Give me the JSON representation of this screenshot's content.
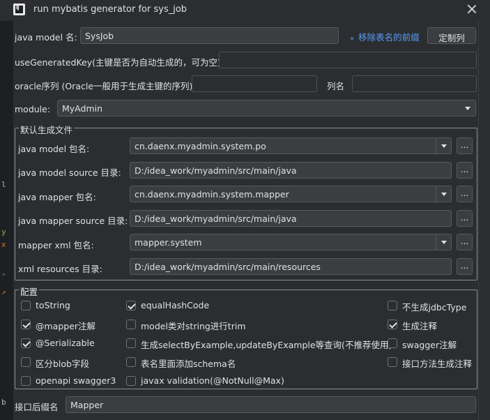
{
  "window": {
    "title": "run mybatis generator for sys_job"
  },
  "model_row": {
    "label": "java model 名:",
    "value": "SysJob",
    "link": "移除表名的前缀",
    "button": "定制列"
  },
  "generated_key": {
    "label": "useGeneratedKey(主键是否为自动生成的，可为空):",
    "value": ""
  },
  "oracle": {
    "label": "oracle序列 (Oracle一般用于生成主键的序列)",
    "value": "",
    "column_label": "列名",
    "column_value": ""
  },
  "module": {
    "label": "module:",
    "value": "MyAdmin"
  },
  "defaults_group": {
    "title": "默认生成文件",
    "rows": [
      {
        "label": "java model 包名:",
        "value": "cn.daenx.myadmin.system.po",
        "combo": true
      },
      {
        "label": "java model source 目录:",
        "value": "D:/idea_work/myadmin/src/main/java",
        "combo": false
      },
      {
        "label": "java mapper 包名:",
        "value": "cn.daenx.myadmin.system.mapper",
        "combo": true
      },
      {
        "label": "java mapper source 目录:",
        "value": "D:/idea_work/myadmin/src/main/java",
        "combo": false
      },
      {
        "label": "mapper xml 包名:",
        "value": "mapper.system",
        "combo": true
      },
      {
        "label": "xml resources 目录:",
        "value": "D:/idea_work/myadmin/src/main/resources",
        "combo": false
      }
    ],
    "browse_label": "..."
  },
  "config_group": {
    "title": "配置",
    "options": [
      {
        "label": "toString",
        "checked": false
      },
      {
        "label": "equalHashCode",
        "checked": true
      },
      {
        "label": "不生成jdbcType",
        "checked": false
      },
      {
        "label": "@mapper注解",
        "checked": true
      },
      {
        "label": "model类对string进行trim",
        "checked": false
      },
      {
        "label": "生成注释",
        "checked": true
      },
      {
        "label": "@Serializable",
        "checked": true
      },
      {
        "label": "生成selectByExample,updateByExample等查询(不推荐使用)",
        "checked": false
      },
      {
        "label": "swagger注解",
        "checked": false
      },
      {
        "label": "区分blob字段",
        "checked": false
      },
      {
        "label": "表名里面添加schema名",
        "checked": false
      },
      {
        "label": "接口方法生成注释",
        "checked": false
      },
      {
        "label": "openapi swagger3",
        "checked": false
      },
      {
        "label": "javax validation(@NotNull@Max)",
        "checked": false
      }
    ]
  },
  "interface_suffix": {
    "label": "接口后缀名",
    "value": "Mapper"
  },
  "editor_strip": {
    "glyphs": [
      "l",
      "y",
      "x",
      "\"",
      "↗",
      "b"
    ]
  },
  "colors": {
    "background": "#2b2d30",
    "link": "#589df6",
    "border": "#4e5157"
  }
}
